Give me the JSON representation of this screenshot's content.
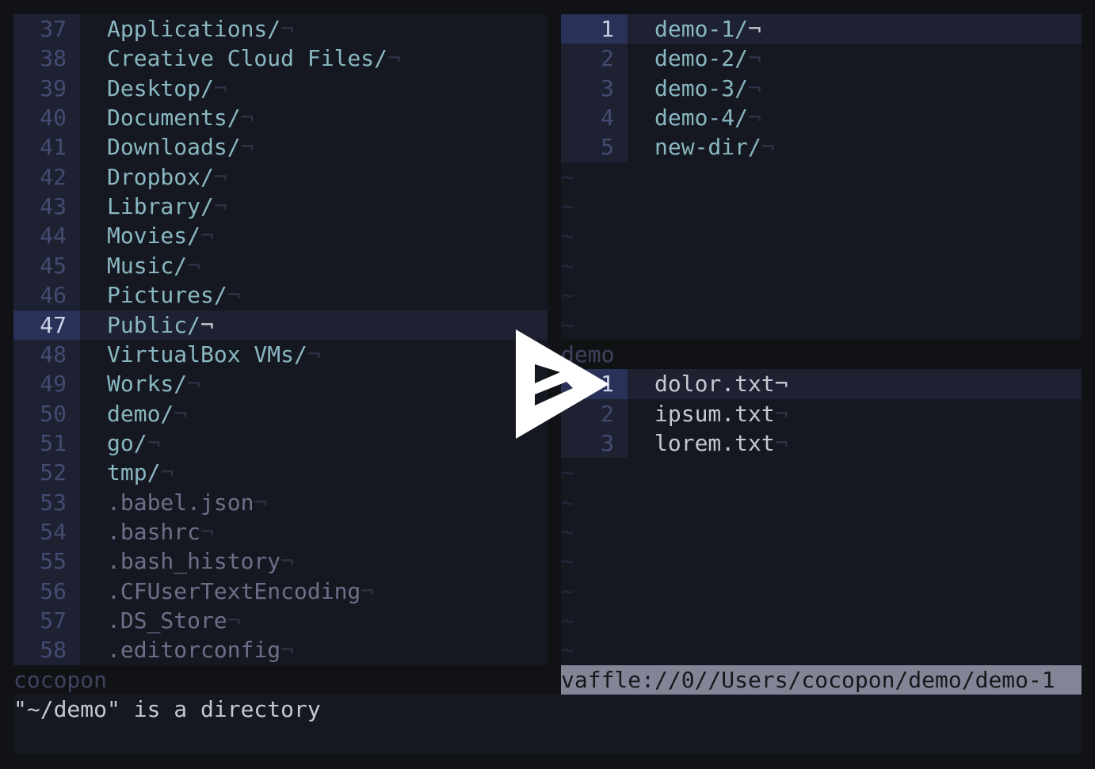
{
  "left_pane": {
    "cursor_line": 47,
    "lines": [
      {
        "num": "37",
        "text": "Applications/",
        "kind": "dir"
      },
      {
        "num": "38",
        "text": "Creative Cloud Files/",
        "kind": "dir"
      },
      {
        "num": "39",
        "text": "Desktop/",
        "kind": "dir"
      },
      {
        "num": "40",
        "text": "Documents/",
        "kind": "dir"
      },
      {
        "num": "41",
        "text": "Downloads/",
        "kind": "dir"
      },
      {
        "num": "42",
        "text": "Dropbox/",
        "kind": "dir"
      },
      {
        "num": "43",
        "text": "Library/",
        "kind": "dir"
      },
      {
        "num": "44",
        "text": "Movies/",
        "kind": "dir"
      },
      {
        "num": "45",
        "text": "Music/",
        "kind": "dir"
      },
      {
        "num": "46",
        "text": "Pictures/",
        "kind": "dir"
      },
      {
        "num": "47",
        "text": "Public/",
        "kind": "dir"
      },
      {
        "num": "48",
        "text": "VirtualBox VMs/",
        "kind": "dir"
      },
      {
        "num": "49",
        "text": "Works/",
        "kind": "dir"
      },
      {
        "num": "50",
        "text": "demo/",
        "kind": "dir"
      },
      {
        "num": "51",
        "text": "go/",
        "kind": "dir"
      },
      {
        "num": "52",
        "text": "tmp/",
        "kind": "dir"
      },
      {
        "num": "53",
        "text": ".babel.json",
        "kind": "dot"
      },
      {
        "num": "54",
        "text": ".bashrc",
        "kind": "dot"
      },
      {
        "num": "55",
        "text": ".bash_history",
        "kind": "dot"
      },
      {
        "num": "56",
        "text": ".CFUserTextEncoding",
        "kind": "dot"
      },
      {
        "num": "57",
        "text": ".DS_Store",
        "kind": "dot"
      },
      {
        "num": "58",
        "text": ".editorconfig",
        "kind": "dot"
      }
    ],
    "status": "cocopon"
  },
  "right_top_pane": {
    "cursor_line": 1,
    "lines": [
      {
        "num": "1",
        "text": "demo-1/",
        "kind": "dir"
      },
      {
        "num": "2",
        "text": "demo-2/",
        "kind": "dir"
      },
      {
        "num": "3",
        "text": "demo-3/",
        "kind": "dir"
      },
      {
        "num": "4",
        "text": "demo-4/",
        "kind": "dir"
      },
      {
        "num": "5",
        "text": "new-dir/",
        "kind": "dir"
      }
    ],
    "status": "demo"
  },
  "right_bottom_pane": {
    "cursor_line": 1,
    "lines": [
      {
        "num": "1",
        "text": "dolor.txt",
        "kind": "file"
      },
      {
        "num": "2",
        "text": "ipsum.txt",
        "kind": "file"
      },
      {
        "num": "3",
        "text": "lorem.txt",
        "kind": "file"
      }
    ],
    "status": "vaffle://0//Users/cocopon/demo/demo-1"
  },
  "eol_marker": "¬",
  "tilde": "~",
  "message": "\"~/demo\" is a directory",
  "play_button": {
    "icon": "asciinema-play-icon"
  },
  "colors": {
    "background": "#161821",
    "directory": "#89b8c2",
    "file": "#c6c8d1",
    "dotfile": "#6b7089",
    "line_number": "#444b71",
    "active_status": "#818596"
  }
}
